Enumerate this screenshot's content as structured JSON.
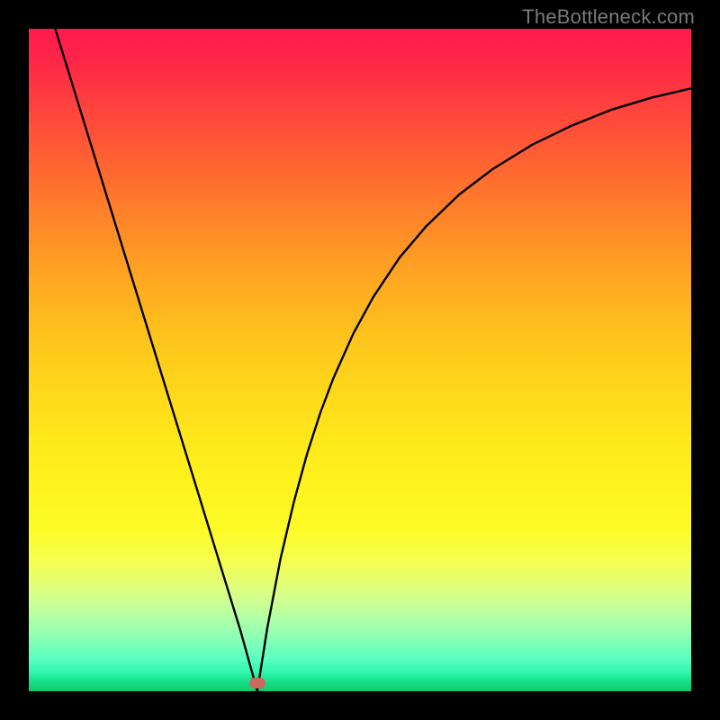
{
  "watermark": "TheBottleneck.com",
  "colors": {
    "frame": "#000000",
    "curve": "#000000",
    "marker": "#c96a5e",
    "gradient_stops": [
      "#ff1a4d",
      "#ff2748",
      "#ff4b3a",
      "#ff6a2f",
      "#ff8a28",
      "#ffa821",
      "#ffc21d",
      "#ffd61b",
      "#ffe81c",
      "#fff41e",
      "#fdfb2a",
      "#f6ff4c",
      "#e7ff6e",
      "#d2ff8e",
      "#b2ffa6",
      "#8affb6",
      "#5cffc0",
      "#33f7b3",
      "#1de896",
      "#14d77f",
      "#0ecb6f"
    ]
  },
  "chart_data": {
    "type": "line",
    "title": "",
    "xlabel": "",
    "ylabel": "",
    "xlim": [
      0,
      1
    ],
    "ylim": [
      0,
      1
    ],
    "bottleneck_x": 0.345,
    "marker": {
      "x": 0.345,
      "y": 0.012
    },
    "series": [
      {
        "name": "left_branch",
        "x": [
          0.04,
          0.08,
          0.12,
          0.16,
          0.2,
          0.24,
          0.28,
          0.32,
          0.345
        ],
        "y": [
          1.0,
          0.87,
          0.74,
          0.61,
          0.48,
          0.35,
          0.22,
          0.09,
          0.0
        ]
      },
      {
        "name": "right_branch",
        "x": [
          0.345,
          0.36,
          0.38,
          0.4,
          0.42,
          0.44,
          0.46,
          0.49,
          0.52,
          0.56,
          0.6,
          0.65,
          0.7,
          0.76,
          0.82,
          0.88,
          0.94,
          1.0
        ],
        "y": [
          0.0,
          0.095,
          0.2,
          0.285,
          0.358,
          0.42,
          0.473,
          0.54,
          0.595,
          0.655,
          0.702,
          0.75,
          0.788,
          0.825,
          0.854,
          0.878,
          0.896,
          0.91
        ]
      }
    ]
  }
}
